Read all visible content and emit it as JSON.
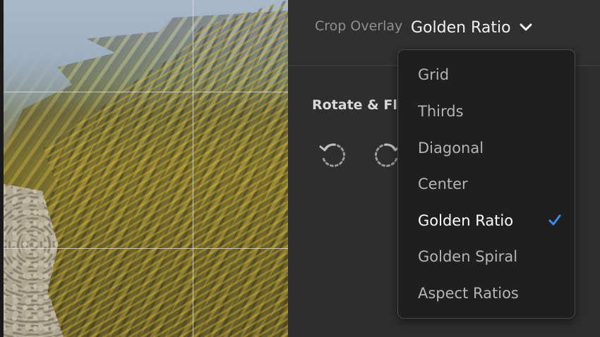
{
  "crop": {
    "label": "Crop Overlay",
    "value": "Golden Ratio"
  },
  "rotate": {
    "title": "Rotate & Flip",
    "buttons": [
      {
        "icon": "rotate-left-icon"
      },
      {
        "icon": "rotate-right-icon"
      }
    ]
  },
  "menu": {
    "items": [
      {
        "label": "Grid",
        "selected": false
      },
      {
        "label": "Thirds",
        "selected": false
      },
      {
        "label": "Diagonal",
        "selected": false
      },
      {
        "label": "Center",
        "selected": false
      },
      {
        "label": "Golden Ratio",
        "selected": true
      },
      {
        "label": "Golden Spiral",
        "selected": false
      },
      {
        "label": "Aspect Ratios",
        "selected": false
      }
    ]
  },
  "colors": {
    "accent": "#3b8eea",
    "panel": "#2e2e2e",
    "menu": "#1f1f1f"
  }
}
